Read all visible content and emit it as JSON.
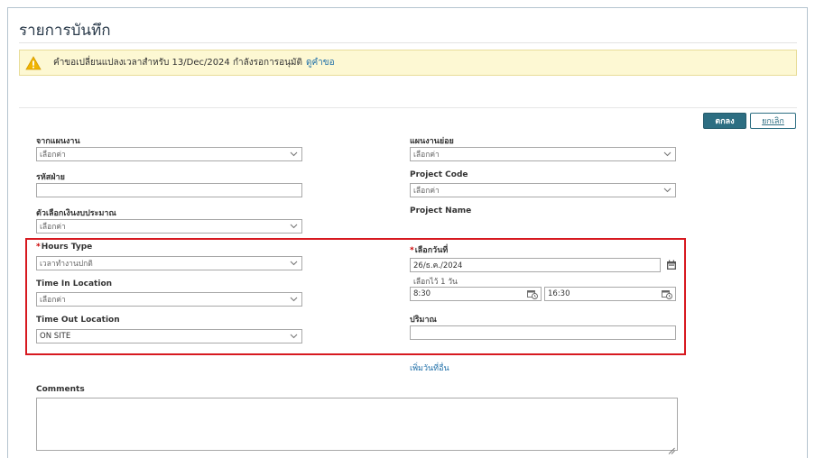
{
  "page": {
    "title": "รายการบันทึก"
  },
  "banner": {
    "message": "คำขอเปลี่ยนแปลงเวลาสำหรับ 13/Dec/2024 กำลังรอการอนุมัติ",
    "link": "ดูคำขอ",
    "icon": "warning-triangle-icon",
    "color": "#f0b400"
  },
  "actions": {
    "ok_label": "ตกลง",
    "cancel_label": "ยกเลิก",
    "accent": "#2d6e82"
  },
  "form": {
    "from_plan": {
      "label": "จากแผนงาน",
      "value": "เลือกค่า"
    },
    "sub_plan": {
      "label": "แผนงานย่อย",
      "value": "เลือกค่า"
    },
    "dept_code": {
      "label": "รหัสฝ่าย",
      "value": ""
    },
    "project_code": {
      "label": "Project Code",
      "value": "เลือกค่า"
    },
    "budget_option": {
      "label": "ตัวเลือกเงินงบประมาณ",
      "value": "เลือกค่า"
    },
    "project_name": {
      "label": "Project Name"
    },
    "hours_type": {
      "required_mark": "*",
      "label": "Hours Type",
      "value": "เวลาทำงานปกติ"
    },
    "select_date": {
      "required_mark": "*",
      "label": "เลือกวันที่",
      "value": "26/ธ.ค./2024",
      "hint": "เลือกไว้ 1 วัน"
    },
    "time_in_location": {
      "label": "Time In Location",
      "value": "เลือกค่า"
    },
    "time_start": {
      "value": "8:30"
    },
    "time_end": {
      "value": "16:30"
    },
    "time_out_location": {
      "label": "Time Out Location",
      "value": "ON SITE"
    },
    "quantity": {
      "label": "ปริมาณ",
      "value": ""
    },
    "add_date_link": "เพิ่มวันที่อื่น",
    "comments": {
      "label": "Comments",
      "value": ""
    }
  }
}
